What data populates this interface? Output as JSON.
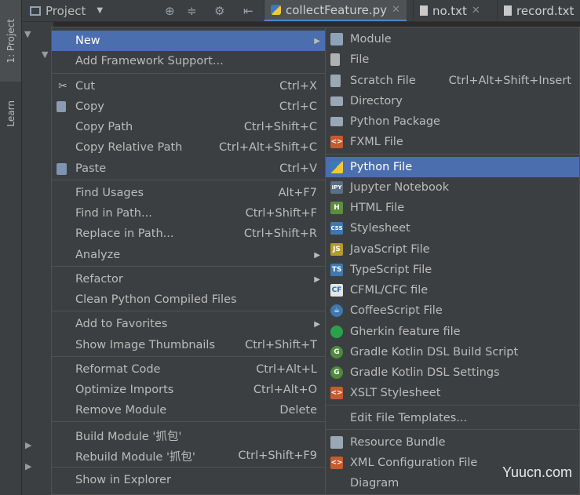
{
  "sidebar": {
    "project_tab": "1: Project",
    "learn_tab": "Learn"
  },
  "header": {
    "project_label": "Project",
    "tabs": [
      {
        "label": "collectFeature.py"
      },
      {
        "label": "no.txt"
      },
      {
        "label": "record.txt"
      }
    ]
  },
  "context_menu": {
    "items": [
      {
        "label": "New",
        "shortcut": "",
        "submenu": true,
        "selected": true
      },
      {
        "label": "Add Framework Support...",
        "shortcut": ""
      },
      {
        "label": "Cut",
        "shortcut": "Ctrl+X",
        "icon": "scissors-icon"
      },
      {
        "label": "Copy",
        "shortcut": "Ctrl+C",
        "icon": "copy-icon"
      },
      {
        "label": "Copy Path",
        "shortcut": "Ctrl+Shift+C"
      },
      {
        "label": "Copy Relative Path",
        "shortcut": "Ctrl+Alt+Shift+C"
      },
      {
        "label": "Paste",
        "shortcut": "Ctrl+V",
        "icon": "paste-icon"
      },
      {
        "label": "Find Usages",
        "shortcut": "Alt+F7"
      },
      {
        "label": "Find in Path...",
        "shortcut": "Ctrl+Shift+F"
      },
      {
        "label": "Replace in Path...",
        "shortcut": "Ctrl+Shift+R"
      },
      {
        "label": "Analyze",
        "shortcut": "",
        "submenu": true
      },
      {
        "label": "Refactor",
        "shortcut": "",
        "submenu": true
      },
      {
        "label": "Clean Python Compiled Files",
        "shortcut": ""
      },
      {
        "label": "Add to Favorites",
        "shortcut": "",
        "submenu": true
      },
      {
        "label": "Show Image Thumbnails",
        "shortcut": "Ctrl+Shift+T"
      },
      {
        "label": "Reformat Code",
        "shortcut": "Ctrl+Alt+L"
      },
      {
        "label": "Optimize Imports",
        "shortcut": "Ctrl+Alt+O"
      },
      {
        "label": "Remove Module",
        "shortcut": "Delete"
      },
      {
        "label": "Build Module '抓包'",
        "shortcut": ""
      },
      {
        "label": "Rebuild Module '抓包'",
        "shortcut": "Ctrl+Shift+F9"
      },
      {
        "label": "Show in Explorer",
        "shortcut": ""
      }
    ]
  },
  "new_submenu": {
    "items": [
      {
        "label": "Module",
        "icon": "module-icon"
      },
      {
        "label": "File",
        "icon": "file-icon"
      },
      {
        "label": "Scratch File",
        "shortcut": "Ctrl+Alt+Shift+Insert",
        "icon": "scratch-file-icon"
      },
      {
        "label": "Directory",
        "icon": "folder-icon"
      },
      {
        "label": "Python Package",
        "icon": "package-icon"
      },
      {
        "label": "FXML File",
        "icon": "fxml-icon"
      },
      {
        "label": "Python File",
        "icon": "python-icon",
        "selected": true
      },
      {
        "label": "Jupyter Notebook",
        "icon": "jupyter-icon"
      },
      {
        "label": "HTML File",
        "icon": "html-icon"
      },
      {
        "label": "Stylesheet",
        "icon": "css-icon"
      },
      {
        "label": "JavaScript File",
        "icon": "js-icon"
      },
      {
        "label": "TypeScript File",
        "icon": "ts-icon"
      },
      {
        "label": "CFML/CFC file",
        "icon": "cf-icon"
      },
      {
        "label": "CoffeeScript File",
        "icon": "coffee-icon"
      },
      {
        "label": "Gherkin feature file",
        "icon": "gherkin-icon"
      },
      {
        "label": "Gradle Kotlin DSL Build Script",
        "icon": "gradle-icon"
      },
      {
        "label": "Gradle Kotlin DSL Settings",
        "icon": "gradle-icon"
      },
      {
        "label": "XSLT Stylesheet",
        "icon": "xslt-icon"
      },
      {
        "label": "Edit File Templates..."
      },
      {
        "label": "Resource Bundle",
        "icon": "resource-bundle-icon"
      },
      {
        "label": "XML Configuration File",
        "icon": "xml-icon"
      },
      {
        "label": "Diagram"
      }
    ]
  },
  "watermark": "Yuucn.com",
  "colors": {
    "menu_bg": "#3c3f41",
    "selection": "#4b6eaf",
    "editor_bg": "#2b2b2b"
  }
}
